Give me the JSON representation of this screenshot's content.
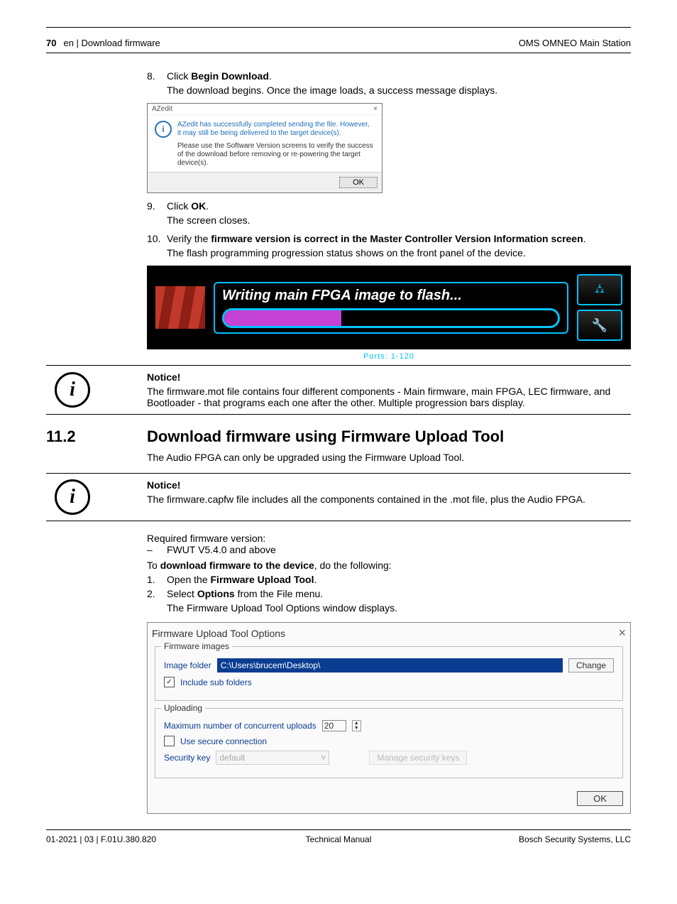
{
  "header": {
    "page_number": "70",
    "left_text": "en | Download firmware",
    "right_text": "OMS OMNEO Main Station"
  },
  "steps": {
    "s8_num": "8.",
    "s8_text_a": "Click ",
    "s8_text_bold": "Begin Download",
    "s8_text_c": ".",
    "s8_sub": "The download begins. Once the image loads, a success message displays.",
    "s9_num": "9.",
    "s9_text_a": "Click ",
    "s9_text_bold": "OK",
    "s9_text_c": ".",
    "s9_sub": "The screen closes.",
    "s10_num": "10.",
    "s10_text_a": "Verify the ",
    "s10_text_bold": "firmware version is correct in the Master Controller Version Information screen",
    "s10_text_c": ".",
    "s10_sub": "The flash programming progression status shows on the front panel of the device."
  },
  "azedit": {
    "title": "AZedit",
    "close": "×",
    "msg1": "AZedit has successfully completed sending the file. However, it may still be being delivered to the target device(s).",
    "msg2": "Please use the Software Version screens to verify the success of the download before removing or re-powering the target device(s).",
    "ok": "OK"
  },
  "device": {
    "writing": "Writing main FPGA image to flash...",
    "ports": "Ports: 1-120"
  },
  "notice1": {
    "title": "Notice!",
    "body": "The firmware.mot file contains four different components - Main firmware, main FPGA, LEC firmware, and Bootloader - that programs each one after the other. Multiple progression bars display."
  },
  "section": {
    "num": "11.2",
    "title": "Download firmware using Firmware Upload Tool",
    "intro": "The Audio FPGA can only be upgraded using the Firmware Upload Tool."
  },
  "notice2": {
    "title": "Notice!",
    "body": "The firmware.capfw file includes all the components contained in the .mot file, plus the Audio FPGA."
  },
  "req": {
    "line1": "Required firmware version:",
    "dash": "–",
    "item": "FWUT V5.4.0 and above",
    "to_a": "To ",
    "to_bold": "download firmware to the device",
    "to_c": ", do the following:"
  },
  "steps2": {
    "s1_num": "1.",
    "s1_a": "Open the ",
    "s1_bold": "Firmware Upload Tool",
    "s1_c": ".",
    "s2_num": "2.",
    "s2_a": "Select ",
    "s2_bold": "Options",
    "s2_c": " from the File menu.",
    "s2_sub": "The Firmware Upload Tool Options window displays."
  },
  "fwut": {
    "title": "Firmware Upload Tool Options",
    "close": "×",
    "group1": "Firmware images",
    "image_folder_label": "Image folder",
    "image_folder_value": "C:\\Users\\brucem\\Desktop\\",
    "change": "Change",
    "include_sub": "Include sub folders",
    "include_sub_checked": "✓",
    "group2": "Uploading",
    "max_uploads_label": "Maximum number of concurrent uploads",
    "max_uploads_value": "20",
    "use_secure": "Use secure connection",
    "security_key_label": "Security key",
    "security_key_value": "default",
    "manage_keys": "Manage security keys",
    "ok": "OK"
  },
  "footer": {
    "left": "01-2021 | 03 | F.01U.380.820",
    "center": "Technical Manual",
    "right": "Bosch Security Systems, LLC"
  }
}
